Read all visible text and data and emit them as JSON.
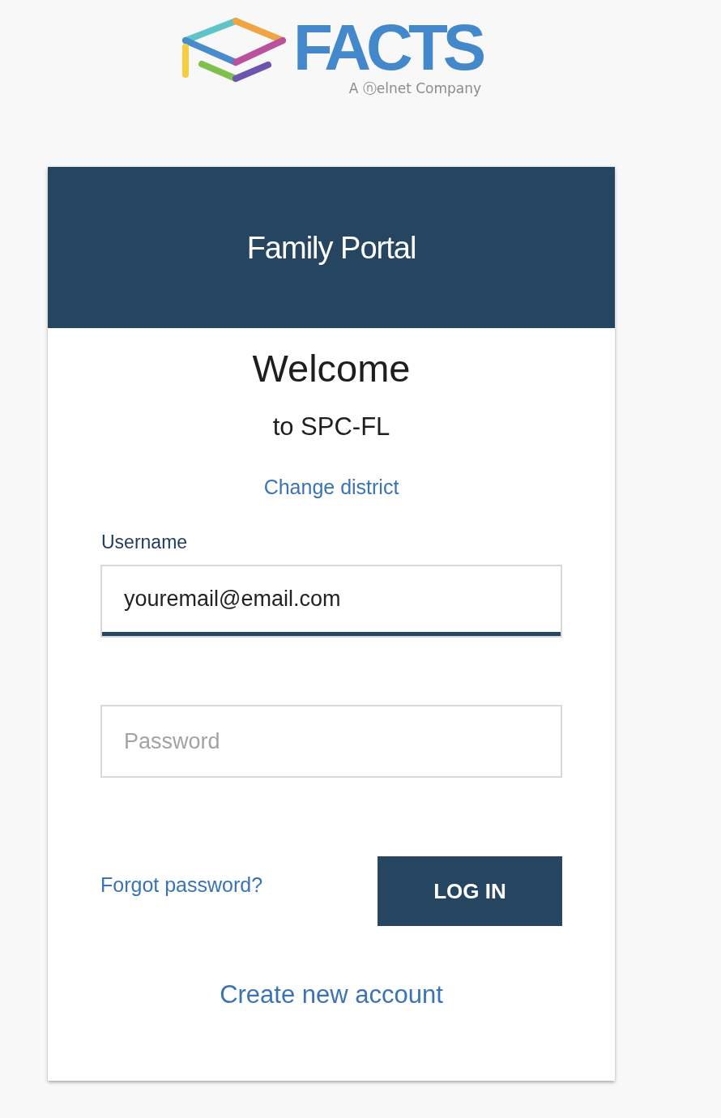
{
  "logo": {
    "wordmark": "FACTS",
    "tagline": "A ⓝelnet Company"
  },
  "header": {
    "title": "Family Portal"
  },
  "welcome": {
    "heading": "Welcome",
    "subtitle": "to SPC-FL",
    "link": "Change district"
  },
  "form": {
    "fields": [
      {
        "kind": "text",
        "label": "Username",
        "value": "youremail@email.com",
        "focused": true
      },
      {
        "kind": "password",
        "placeholder": "Password",
        "focused": false
      }
    ],
    "forgot_link": "Forgot password?",
    "submit": "LOG IN"
  },
  "footer_link": "Create new account"
}
